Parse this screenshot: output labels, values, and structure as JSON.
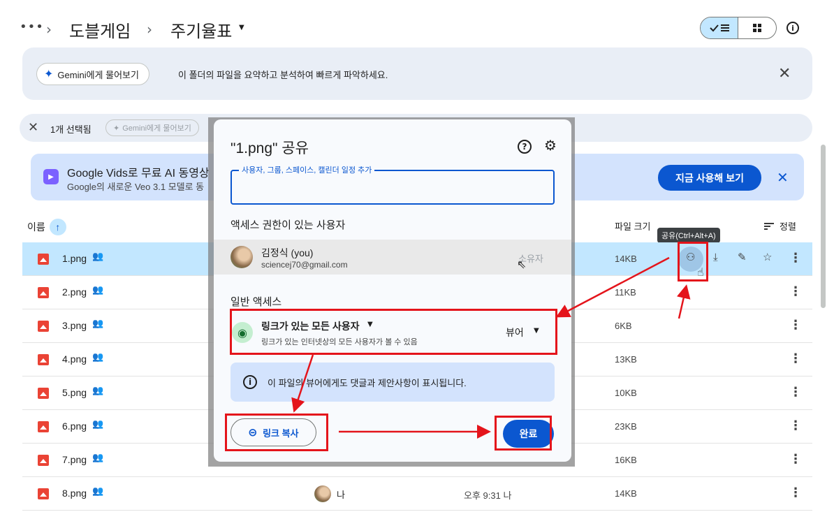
{
  "breadcrumb": {
    "more": "•••",
    "parent": "도블게임",
    "current": "주기율표"
  },
  "icons": {
    "chevron": "chevron-right-icon",
    "list_view": "check-list-icon",
    "grid_view": "grid-icon",
    "info": "info-icon"
  },
  "gemini_bar": {
    "button_label": "Gemini에게 물어보기",
    "text": "이 폴더의 파일을 요약하고 분석하여 빠르게 파악하세요."
  },
  "selection_bar": {
    "count": "1개 선택됨",
    "gemini_label": "Gemini에게 물어보기"
  },
  "promo": {
    "title": "Google Vids로 무료 AI 동영상",
    "subtitle": "Google의 새로운 Veo 3.1 모델로 동",
    "cta": "지금 사용해 보기"
  },
  "columns": {
    "name": "이름",
    "size": "파일 크기",
    "sort": "정렬"
  },
  "files": [
    {
      "name": "1.png",
      "size": "14KB",
      "selected": true
    },
    {
      "name": "2.png",
      "size": "11KB"
    },
    {
      "name": "3.png",
      "size": "6KB"
    },
    {
      "name": "4.png",
      "size": "13KB"
    },
    {
      "name": "5.png",
      "size": "10KB"
    },
    {
      "name": "6.png",
      "size": "23KB"
    },
    {
      "name": "7.png",
      "size": "16KB"
    },
    {
      "name": "8.png",
      "size": "14KB",
      "owner": "나",
      "modified": "오후 9:31 나"
    }
  ],
  "tooltip": "공유(Ctrl+Alt+A)",
  "dialog": {
    "title": "\"1.png\" 공유",
    "input_label": "사용자, 그룹, 스페이스, 캘린더 일정 추가",
    "access_heading": "액세스 권한이 있는 사용자",
    "user": {
      "name": "김정식 (you)",
      "email": "sciencej70@gmail.com",
      "role": "소유자"
    },
    "general_heading": "일반 액세스",
    "link_access": "링크가 있는 모든 사용자",
    "link_desc": "링크가 있는 인터넷상의 모든 사용자가 볼 수 있음",
    "link_role": "뷰어",
    "info_text": "이 파일의 뷰어에게도 댓글과 제안사항이 표시됩니다.",
    "copy_link": "링크 복사",
    "done": "완료"
  },
  "colors": {
    "accent": "#0b57d0",
    "selected_row": "#c2e7ff",
    "annotation": "#e4141b"
  }
}
